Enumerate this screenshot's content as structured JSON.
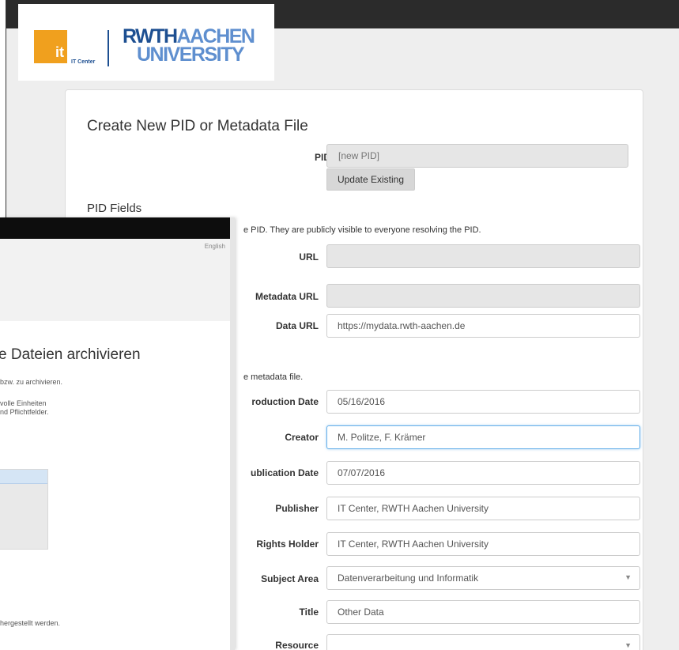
{
  "logo": {
    "it_mark": "it",
    "it_center": "IT Center",
    "rwth": "RWTH",
    "aachen": "AACHEN",
    "university": "UNIVERSITY"
  },
  "form": {
    "title": "Create New PID or Metadata File",
    "pid_label": "PID",
    "pid_placeholder": "[new PID]",
    "update_button": "Update Existing",
    "pid_fields_heading": "PID Fields",
    "pid_fields_info": "e PID. They are publicly visible to everyone resolving the PID.",
    "metadata_info": "e metadata file.",
    "rows": {
      "url": {
        "label": "URL",
        "value": ""
      },
      "metadata_url": {
        "label": "Metadata URL",
        "value": ""
      },
      "data_url": {
        "label": "Data URL",
        "value": "https://mydata.rwth-aachen.de"
      },
      "production_date": {
        "label": "roduction Date",
        "value": "05/16/2016"
      },
      "creator": {
        "label": "Creator",
        "value": "M. Politze, F. Krämer"
      },
      "publication_date": {
        "label": "ublication Date",
        "value": "07/07/2016"
      },
      "publisher": {
        "label": "Publisher",
        "value": "IT Center, RWTH Aachen University"
      },
      "rights_holder": {
        "label": "Rights Holder",
        "value": "IT Center, RWTH Aachen University"
      },
      "subject_area": {
        "label": "Subject Area",
        "value": "Datenverarbeitung und Informatik"
      },
      "title": {
        "label": "Title",
        "value": "Other Data"
      },
      "resource": {
        "label": "Resource",
        "value": ""
      }
    }
  },
  "front": {
    "language": "English",
    "title": "e Dateien archivieren",
    "line1": "bzw. zu archivieren.",
    "line2": "volle Einheiten",
    "line3": "nd Pflichtfelder.",
    "line4": "hergestellt werden."
  },
  "icons": {
    "dropdown": "chevron-down-icon"
  }
}
